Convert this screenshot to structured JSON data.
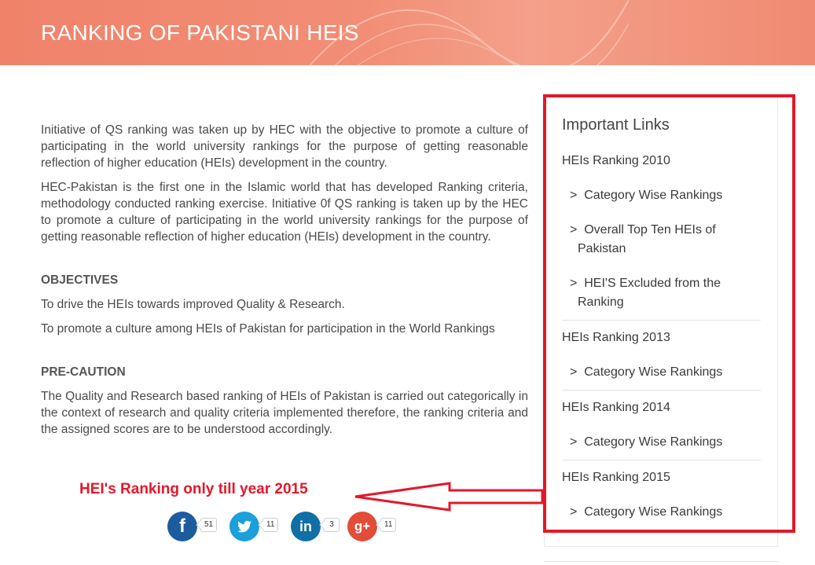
{
  "header": {
    "title": "RANKING OF PAKISTANI HEIS",
    "banner_color": "#f0826a"
  },
  "main": {
    "intro_paragraphs": [
      "Initiative of QS ranking was taken up by HEC with the objective to promote a culture of participating in the world university rankings for the purpose of getting reasonable reflection of higher education (HEIs) development in the country.",
      "HEC-Pakistan is the first one in the Islamic world that has developed Ranking criteria, methodology conducted ranking exercise. Initiative 0f QS ranking is taken up by the HEC to promote a culture of participating in the world university rankings for the purpose of getting reasonable reflection of higher education (HEIs) development in the country."
    ],
    "objectives_heading": "OBJECTIVES",
    "objectives": [
      "To drive the HEIs towards improved Quality & Research.",
      "To promote a culture among HEIs of Pakistan for participation in the World Rankings"
    ],
    "precaution_heading": "PRE-CAUTION",
    "precaution_text": "The Quality and Research based ranking of HEIs of Pakistan is carried out categorically in the context of research and quality criteria implemented therefore, the ranking criteria and the assigned scores are to be understood accordingly."
  },
  "annotation": {
    "text": "HEI's Ranking only till year 2015",
    "color": "#e3182a"
  },
  "sidebar": {
    "title": "Important Links",
    "groups": [
      {
        "label": "HEIs Ranking 2010",
        "items": [
          {
            "prefix": ">",
            "line1": "Category Wise Rankings",
            "line2": ""
          },
          {
            "prefix": ">",
            "line1": "Overall Top Ten HEIs of",
            "line2": "Pakistan"
          },
          {
            "prefix": ">",
            "line1": "HEI'S Excluded from the",
            "line2": "Ranking"
          }
        ]
      },
      {
        "label": "HEIs Ranking 2013",
        "items": [
          {
            "prefix": ">",
            "line1": "Category Wise Rankings",
            "line2": ""
          }
        ]
      },
      {
        "label": "HEIs Ranking 2014",
        "items": [
          {
            "prefix": ">",
            "line1": "Category Wise Rankings",
            "line2": ""
          }
        ]
      },
      {
        "label": "HEIs Ranking 2015",
        "items": [
          {
            "prefix": ">",
            "line1": "Category Wise Rankings",
            "line2": ""
          }
        ]
      }
    ]
  },
  "share": {
    "facebook": {
      "icon": "facebook-icon",
      "glyph": "f",
      "count": "51"
    },
    "twitter": {
      "icon": "twitter-icon",
      "count": "11"
    },
    "linkedin": {
      "icon": "linkedin-icon",
      "glyph": "in",
      "count": "3"
    },
    "googleplus": {
      "icon": "google-plus-icon",
      "glyph": "g+",
      "count": "11"
    }
  }
}
